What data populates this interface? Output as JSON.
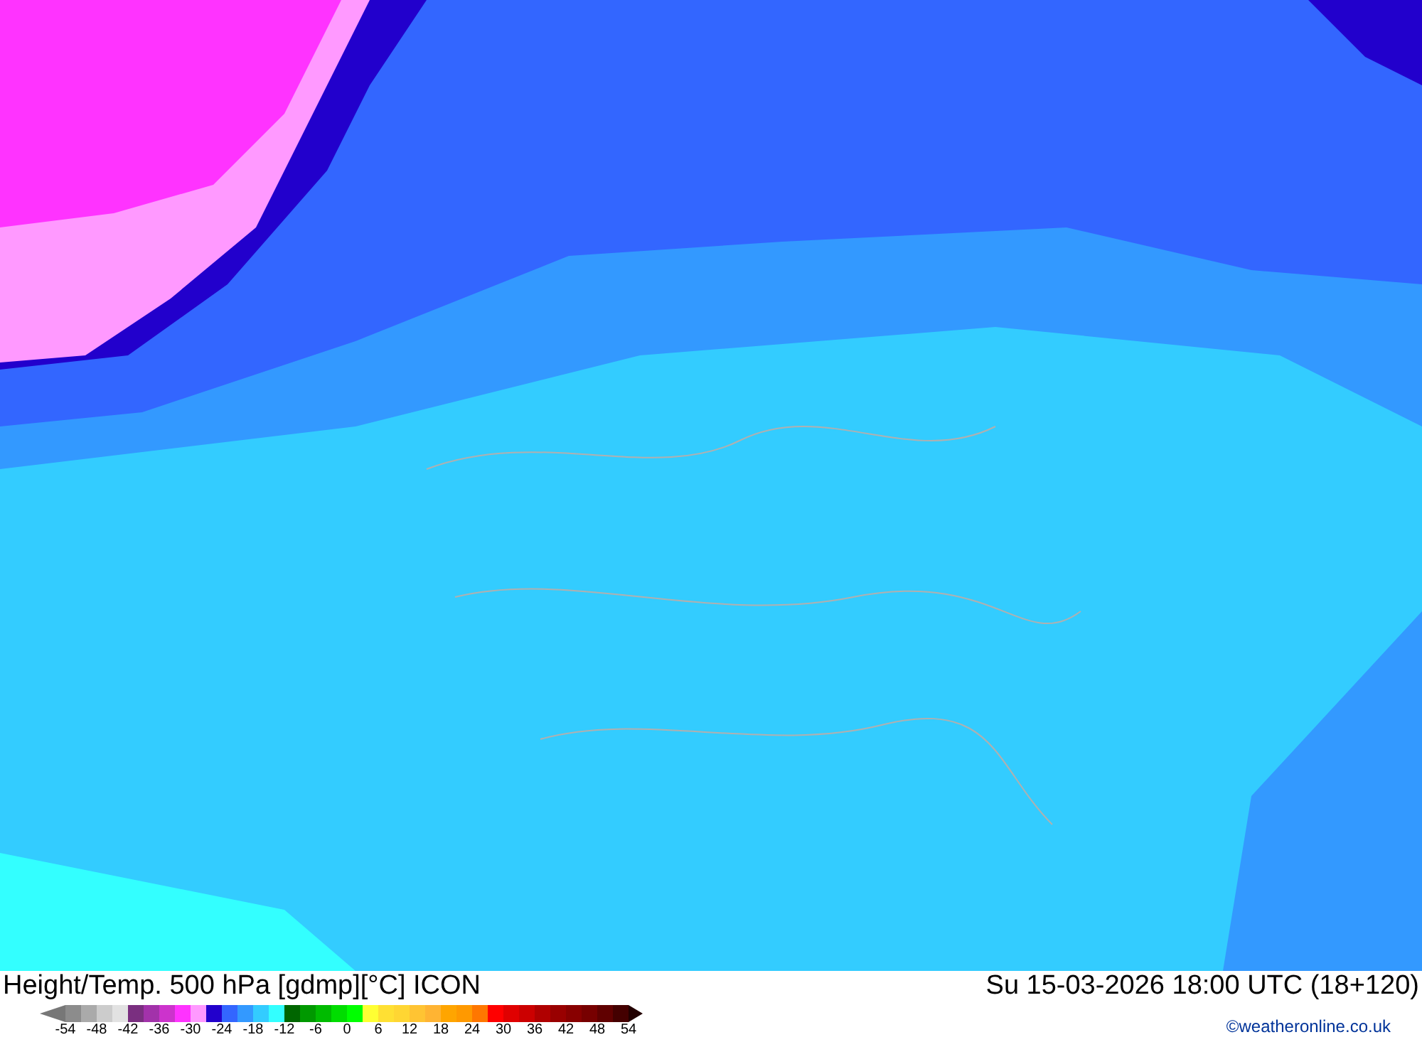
{
  "title": "Height/Temp. 500 hPa [gdmp][°C] ICON",
  "valid_time": "Su 15-03-2026 18:00 UTC (18+120)",
  "legend": {
    "swatches": [
      {
        "color": "#8c8c8c"
      },
      {
        "color": "#aaaaaa"
      },
      {
        "color": "#cccccc"
      },
      {
        "color": "#e2e2e2"
      },
      {
        "color": "#7a2f80"
      },
      {
        "color": "#a232aa"
      },
      {
        "color": "#cc33cc"
      },
      {
        "color": "#ff33ff"
      },
      {
        "color": "#ff99ff"
      },
      {
        "color": "#2200cc"
      },
      {
        "color": "#3366ff"
      },
      {
        "color": "#3399ff"
      },
      {
        "color": "#33ccff"
      },
      {
        "color": "#33ffff"
      },
      {
        "color": "#006600"
      },
      {
        "color": "#009900"
      },
      {
        "color": "#00bb00"
      },
      {
        "color": "#00dd00"
      },
      {
        "color": "#00ff00"
      },
      {
        "color": "#ffff33"
      },
      {
        "color": "#ffe033"
      },
      {
        "color": "#ffd633"
      },
      {
        "color": "#ffc433"
      },
      {
        "color": "#ffb433"
      },
      {
        "color": "#ffa500"
      },
      {
        "color": "#ff9900"
      },
      {
        "color": "#ff7700"
      },
      {
        "color": "#ff0000"
      },
      {
        "color": "#e00000"
      },
      {
        "color": "#cc0000"
      },
      {
        "color": "#b00000"
      },
      {
        "color": "#990000"
      },
      {
        "color": "#880000"
      },
      {
        "color": "#770000"
      },
      {
        "color": "#600000"
      },
      {
        "color": "#440000"
      }
    ],
    "ticks": [
      "-54",
      "-48",
      "-42",
      "-36",
      "-30",
      "-24",
      "-18",
      "-12",
      "-6",
      "0",
      "6",
      "12",
      "18",
      "24",
      "30",
      "36",
      "42",
      "48",
      "54"
    ]
  },
  "credit": "©weatheronline.co.uk"
}
